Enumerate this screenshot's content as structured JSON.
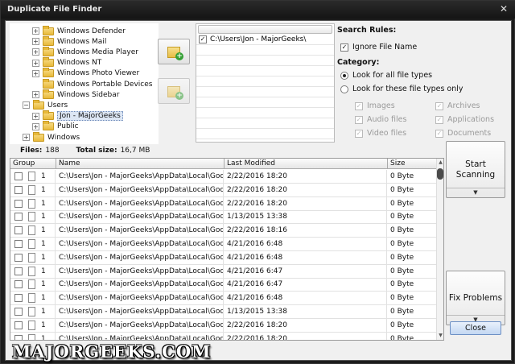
{
  "window": {
    "title": "Duplicate File Finder",
    "close_glyph": "✕"
  },
  "tree": [
    {
      "label": "Windows Defender",
      "level": 3,
      "expander": "+"
    },
    {
      "label": "Windows Mail",
      "level": 3,
      "expander": "+"
    },
    {
      "label": "Windows Media Player",
      "level": 3,
      "expander": "+"
    },
    {
      "label": "Windows NT",
      "level": 3,
      "expander": "+"
    },
    {
      "label": "Windows Photo Viewer",
      "level": 3,
      "expander": "+"
    },
    {
      "label": "Windows Portable Devices",
      "level": 3,
      "expander": ""
    },
    {
      "label": "Windows Sidebar",
      "level": 3,
      "expander": "+"
    },
    {
      "label": "Users",
      "level": 1,
      "expander": "−"
    },
    {
      "label": "Jon - MajorGeeks",
      "level": 2,
      "expander": "+",
      "selected": true
    },
    {
      "label": "Public",
      "level": 2,
      "expander": "+"
    },
    {
      "label": "Windows",
      "level": 1,
      "expander": "+"
    }
  ],
  "folders": [
    {
      "path": "C:\\Users\\Jon - MajorGeeks\\",
      "checked": true
    }
  ],
  "rules": {
    "search_heading": "Search Rules:",
    "ignore_name": {
      "label": "Ignore File Name",
      "checked": true
    },
    "category_heading": "Category:",
    "radio_all": {
      "label": "Look for all file types",
      "selected": true
    },
    "radio_these": {
      "label": "Look for these file types only",
      "selected": false
    },
    "types": [
      {
        "label": "Images",
        "checked": true
      },
      {
        "label": "Archives",
        "checked": true
      },
      {
        "label": "Audio files",
        "checked": true
      },
      {
        "label": "Applications",
        "checked": true
      },
      {
        "label": "Video files",
        "checked": true
      },
      {
        "label": "Documents",
        "checked": true
      }
    ]
  },
  "stats": {
    "files_label": "Files:",
    "files_value": "188",
    "size_label": "Total size:",
    "size_value": "16,7 MB"
  },
  "table": {
    "columns": [
      "Group",
      "Name",
      "Last Modified",
      "Size"
    ],
    "rows": [
      {
        "group": "1",
        "name": "C:\\Users\\Jon - MajorGeeks\\AppData\\Local\\Goog...",
        "modified": "2/22/2016 18:20",
        "size": "0 Byte"
      },
      {
        "group": "1",
        "name": "C:\\Users\\Jon - MajorGeeks\\AppData\\Local\\Goog...",
        "modified": "2/22/2016 18:20",
        "size": "0 Byte"
      },
      {
        "group": "1",
        "name": "C:\\Users\\Jon - MajorGeeks\\AppData\\Local\\Goog...",
        "modified": "2/22/2016 18:20",
        "size": "0 Byte"
      },
      {
        "group": "1",
        "name": "C:\\Users\\Jon - MajorGeeks\\AppData\\Local\\Goog...",
        "modified": "1/13/2015 13:38",
        "size": "0 Byte"
      },
      {
        "group": "1",
        "name": "C:\\Users\\Jon - MajorGeeks\\AppData\\Local\\Goog...",
        "modified": "2/22/2016 18:16",
        "size": "0 Byte"
      },
      {
        "group": "1",
        "name": "C:\\Users\\Jon - MajorGeeks\\AppData\\Local\\Goog...",
        "modified": "4/21/2016 6:48",
        "size": "0 Byte"
      },
      {
        "group": "1",
        "name": "C:\\Users\\Jon - MajorGeeks\\AppData\\Local\\Goog...",
        "modified": "4/21/2016 6:48",
        "size": "0 Byte"
      },
      {
        "group": "1",
        "name": "C:\\Users\\Jon - MajorGeeks\\AppData\\Local\\Goog...",
        "modified": "4/21/2016 6:47",
        "size": "0 Byte"
      },
      {
        "group": "1",
        "name": "C:\\Users\\Jon - MajorGeeks\\AppData\\Local\\Goog...",
        "modified": "4/21/2016 6:47",
        "size": "0 Byte"
      },
      {
        "group": "1",
        "name": "C:\\Users\\Jon - MajorGeeks\\AppData\\Local\\Goog...",
        "modified": "4/21/2016 6:48",
        "size": "0 Byte"
      },
      {
        "group": "1",
        "name": "C:\\Users\\Jon - MajorGeeks\\AppData\\Local\\Goog...",
        "modified": "1/13/2015 13:38",
        "size": "0 Byte"
      },
      {
        "group": "1",
        "name": "C:\\Users\\Jon - MajorGeeks\\AppData\\Local\\Goog...",
        "modified": "2/22/2016 18:20",
        "size": "0 Byte"
      },
      {
        "group": "1",
        "name": "C:\\Users\\Jon - MajorGeeks\\AppData\\Local\\Goog...",
        "modified": "2/22/2016 18:20",
        "size": "0 Byte"
      }
    ]
  },
  "buttons": {
    "start_line1": "Start",
    "start_line2": "Scanning",
    "fix": "Fix Problems",
    "dropdown_glyph": "▼",
    "close": "Close"
  },
  "watermark": "MAJORGEEKS.COM",
  "icons": {
    "folder": "folder-icon",
    "add_folder": "add-folder-icon",
    "file": "file-icon"
  },
  "colors": {
    "titlebar": "#1c1c1c",
    "client": "#f0f0f0",
    "selected_tree": "#dce6f4",
    "close_button": "#c3d7f2",
    "add_plus": "#35a035"
  }
}
